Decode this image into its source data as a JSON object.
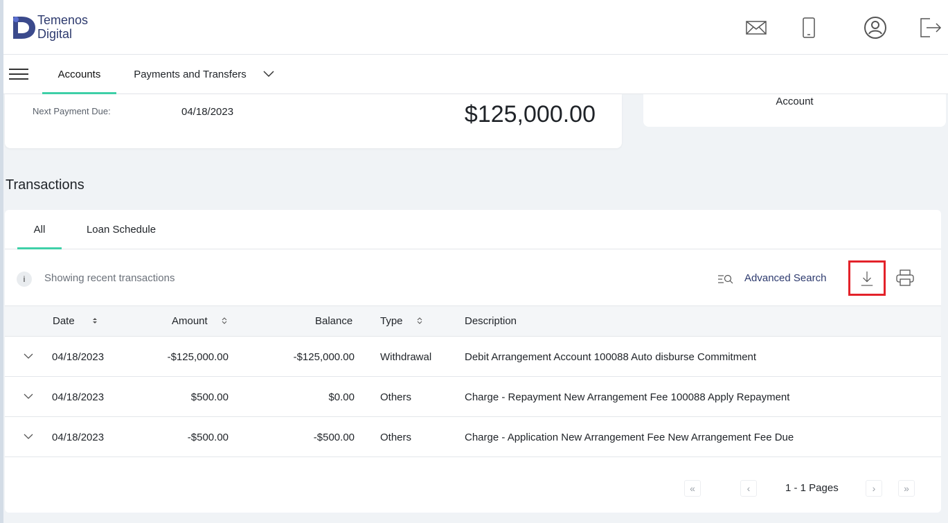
{
  "brand": {
    "line1": "Temenos",
    "line2": "Digital"
  },
  "header_icons": [
    "mail-icon",
    "mobile-icon",
    "user-profile-icon",
    "logout-icon"
  ],
  "nav": {
    "tabs": [
      {
        "label": "Accounts",
        "active": true
      },
      {
        "label": "Payments and Transfers",
        "active": false
      }
    ]
  },
  "account_summary": {
    "next_payment_label": "Next Payment Due:",
    "next_payment_value": "04/18/2023",
    "amount": "$125,000.00",
    "side_card_text": "Account"
  },
  "transactions": {
    "title": "Transactions",
    "tabs": [
      {
        "label": "All",
        "active": true
      },
      {
        "label": "Loan Schedule",
        "active": false
      }
    ],
    "info_icon_text": "i",
    "info_text": "Showing recent transactions",
    "advanced_search": "Advanced Search",
    "columns": [
      "Date",
      "Amount",
      "Balance",
      "Type",
      "Description"
    ],
    "rows": [
      {
        "date": "04/18/2023",
        "amount": "-$125,000.00",
        "balance": "-$125,000.00",
        "type": "Withdrawal",
        "description": "Debit Arrangement Account 100088 Auto disburse Commitment"
      },
      {
        "date": "04/18/2023",
        "amount": "$500.00",
        "balance": "$0.00",
        "type": "Others",
        "description": "Charge - Repayment New Arrangement Fee 100088 Apply Repayment"
      },
      {
        "date": "04/18/2023",
        "amount": "-$500.00",
        "balance": "-$500.00",
        "type": "Others",
        "description": "Charge - Application New Arrangement Fee New Arrangement Fee Due"
      }
    ],
    "pagination": {
      "text": "1 - 1 Pages",
      "first": "«",
      "prev": "‹",
      "next": "›",
      "last": "»"
    }
  },
  "colors": {
    "accent": "#3fd0a8",
    "brand": "#2d3a6e",
    "highlight": "#e3222a",
    "background": "#f0f3f6"
  }
}
